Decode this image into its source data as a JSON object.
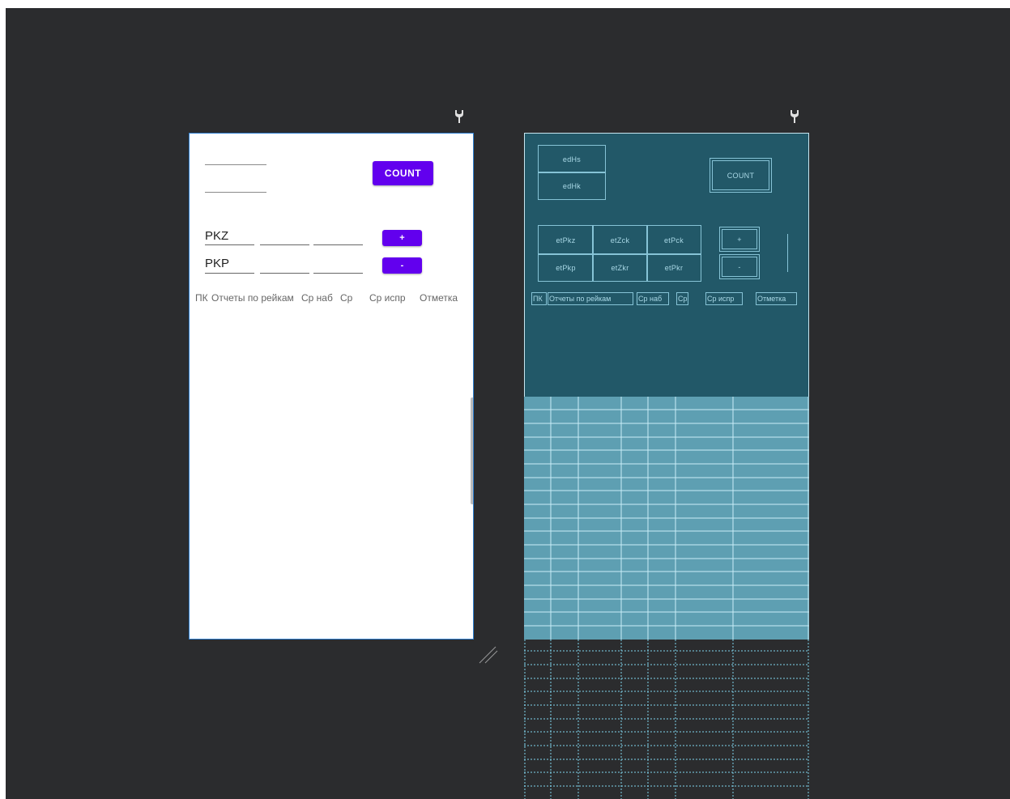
{
  "design": {
    "count_button": "COUNT",
    "rows": [
      {
        "label": "PKZ",
        "button": "+"
      },
      {
        "label": "PKP",
        "button": "-"
      }
    ],
    "headers": [
      "ПК",
      "Отчеты по рейкам",
      "Ср наб",
      "Ср",
      "Ср испр",
      "Отметка"
    ]
  },
  "blueprint": {
    "edit_ids": [
      "edHs",
      "edHk"
    ],
    "count_button": "COUNT",
    "grid_ids": [
      [
        "etPkz",
        "etZck",
        "etPck"
      ],
      [
        "etPkp",
        "etZkr",
        "etPkr"
      ]
    ],
    "buttons": [
      "+",
      "-"
    ],
    "headers": [
      "ПК",
      "Отчеты по рейкам",
      "Ср наб",
      "Ср",
      "Ср испр",
      "Отметка"
    ]
  },
  "colors": {
    "accent": "#6200ee",
    "canvas_bg": "#2b2c2e",
    "blueprint_bg": "#225868",
    "blueprint_line": "#86c3d6",
    "blueprint_table": "#5e9fb2"
  },
  "icons": [
    "wrench-icon",
    "resize-handle-icon"
  ]
}
